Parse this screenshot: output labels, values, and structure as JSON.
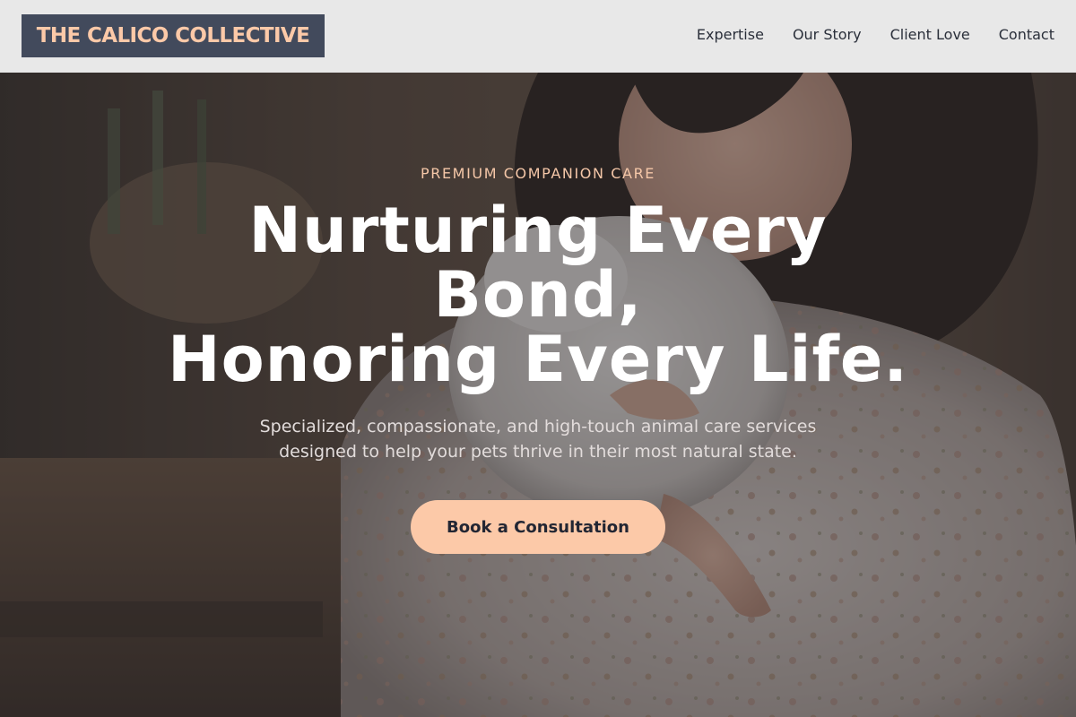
{
  "header": {
    "logo_text": "THE CALICO COLLECTIVE",
    "nav": [
      {
        "label": "Expertise"
      },
      {
        "label": "Our Story"
      },
      {
        "label": "Client Love"
      },
      {
        "label": "Contact"
      }
    ]
  },
  "hero": {
    "eyebrow": "PREMIUM COMPANION CARE",
    "headline_lines": [
      "Nurturing Every",
      "Bond,",
      "Honoring Every Life."
    ],
    "subtext_lines": [
      "Specialized, compassionate, and high-touch animal care services",
      "designed to help your pets thrive in their most natural state."
    ],
    "cta_label": "Book a Consultation",
    "background_image": "photo of a woman in a floral blouse holding a white cat"
  },
  "colors": {
    "header_bg": "#e8e8e8",
    "logo_bg": "#424a5c",
    "accent_peach": "#fcc9a8",
    "nav_text": "#2a2f3a",
    "headline_text": "#ffffff",
    "cta_text": "#222633"
  }
}
